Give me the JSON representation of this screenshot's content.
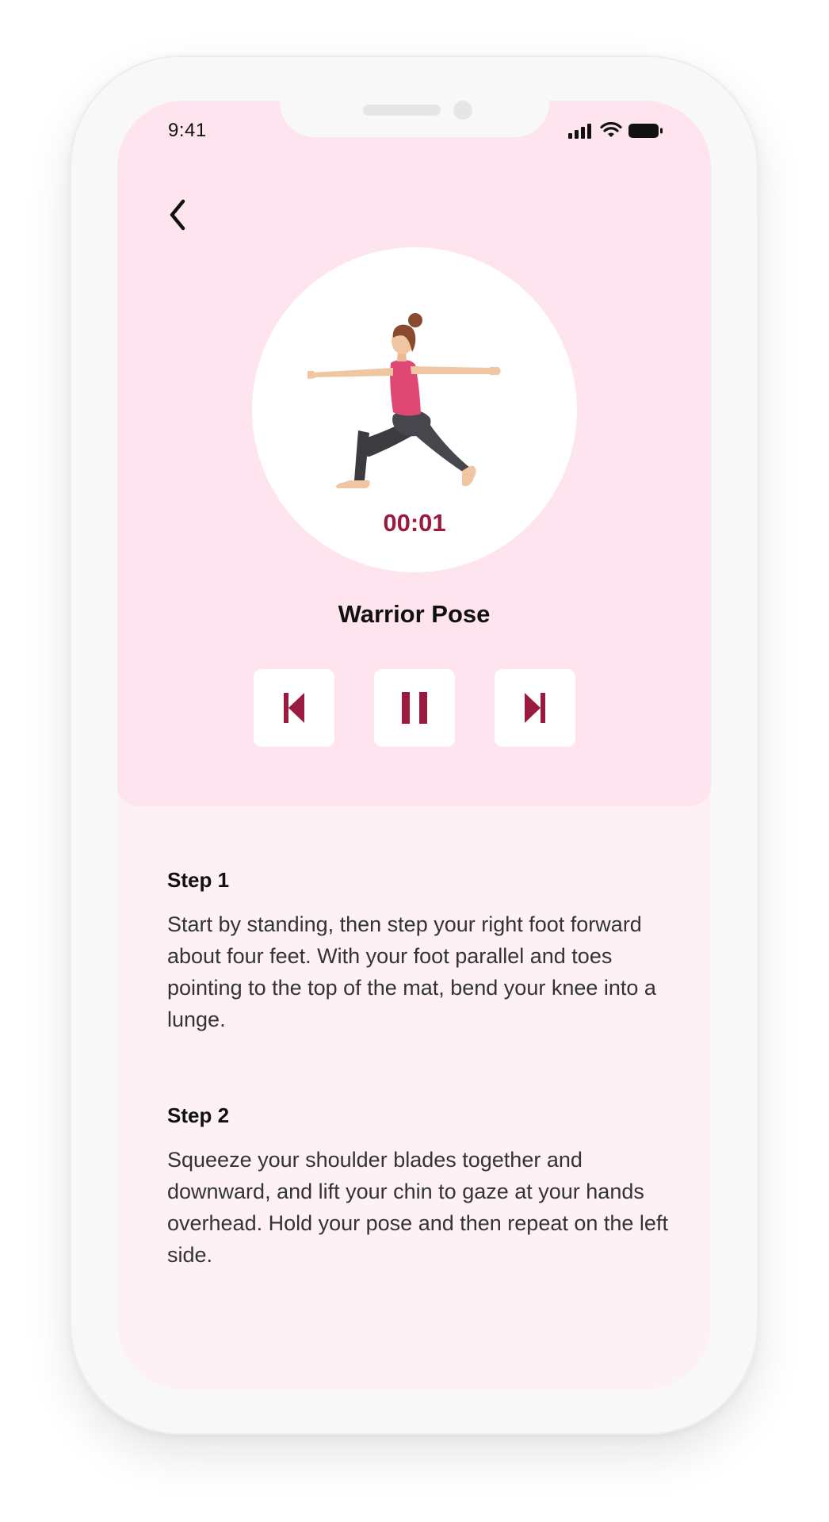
{
  "status_bar": {
    "time": "9:41"
  },
  "nav": {
    "back_icon": "chevron-left-icon"
  },
  "exercise": {
    "timer": "00:01",
    "title": "Warrior Pose"
  },
  "controls": {
    "previous_icon": "skip-previous-icon",
    "pause_icon": "pause-icon",
    "next_icon": "skip-next-icon"
  },
  "steps": [
    {
      "title": "Step 1",
      "text": "Start by standing, then step your right foot forward about four feet. With your foot parallel and toes pointing to the top of the mat, bend your knee into a lunge."
    },
    {
      "title": "Step 2",
      "text": "Squeeze your shoulder blades together and downward, and lift your chin to gaze at your hands overhead. Hold your pose and then repeat on the left side."
    }
  ],
  "colors": {
    "accent": "#9b1b40",
    "top_panel": "#fde4ee",
    "content_bg": "#fef1f5"
  }
}
